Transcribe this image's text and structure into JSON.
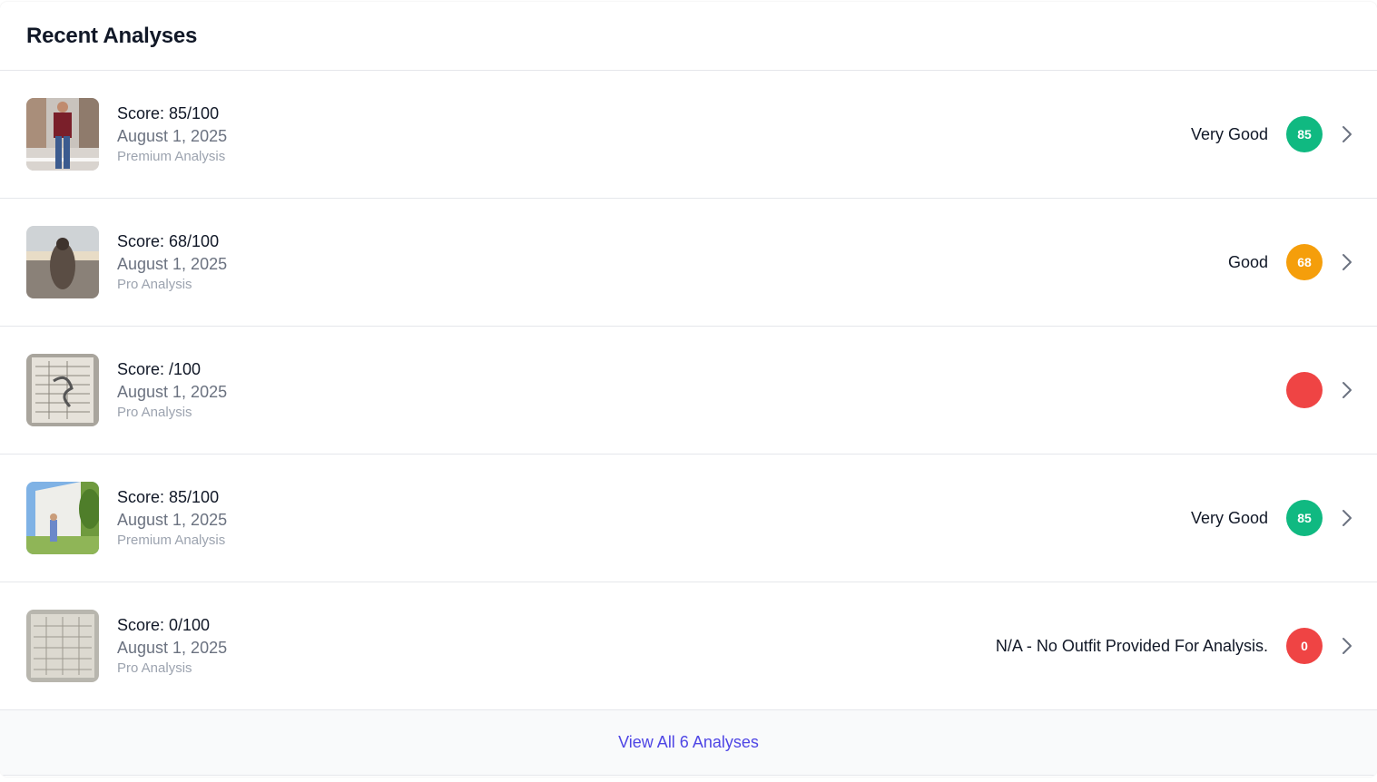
{
  "header": {
    "title": "Recent Analyses"
  },
  "colors": {
    "green": "#10b981",
    "orange": "#f59e0b",
    "red": "#ef4444",
    "link": "#4f46e5"
  },
  "analyses": [
    {
      "score_text": "Score: 85/100",
      "date": "August 1, 2025",
      "tier": "Premium Analysis",
      "rating": "Very Good",
      "badge": "85",
      "badge_color": "#10b981",
      "thumb_icon": "person-street-photo"
    },
    {
      "score_text": "Score: 68/100",
      "date": "August 1, 2025",
      "tier": "Pro Analysis",
      "rating": "Good",
      "badge": "68",
      "badge_color": "#f59e0b",
      "thumb_icon": "beach-photo"
    },
    {
      "score_text": "Score: /100",
      "date": "August 1, 2025",
      "tier": "Pro Analysis",
      "rating": "",
      "badge": "",
      "badge_color": "#ef4444",
      "thumb_icon": "document-photo"
    },
    {
      "score_text": "Score: 85/100",
      "date": "August 1, 2025",
      "tier": "Premium Analysis",
      "rating": "Very Good",
      "badge": "85",
      "badge_color": "#10b981",
      "thumb_icon": "building-garden-photo"
    },
    {
      "score_text": "Score: 0/100",
      "date": "August 1, 2025",
      "tier": "Pro Analysis",
      "rating": "N/A - No Outfit Provided For Analysis.",
      "badge": "0",
      "badge_color": "#ef4444",
      "thumb_icon": "document-photo"
    }
  ],
  "footer": {
    "view_all_label": "View All 6 Analyses"
  }
}
